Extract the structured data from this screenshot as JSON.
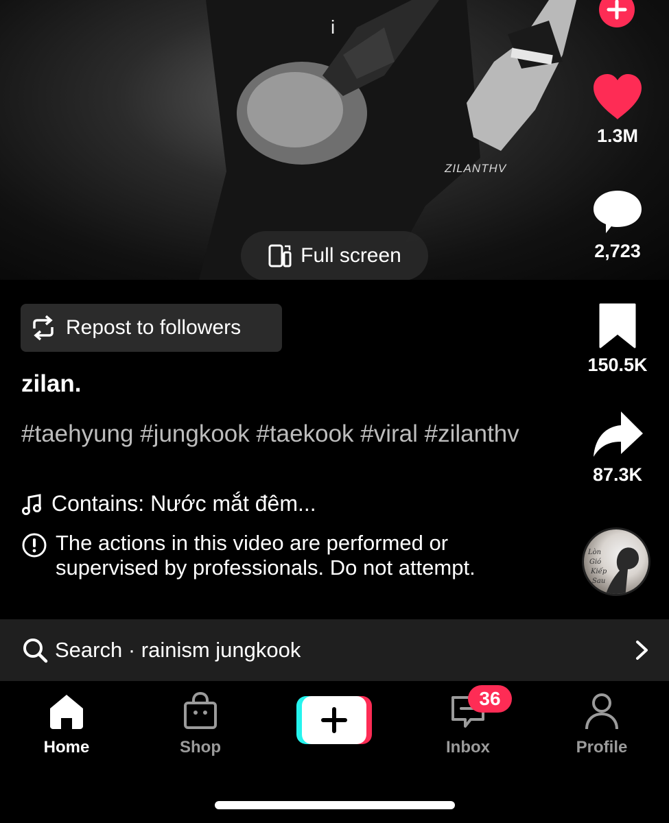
{
  "video": {
    "watermark": "ZILANTHV",
    "glyph": "i",
    "fullscreen_label": "Full screen"
  },
  "actions": {
    "likes": "1.3M",
    "comments": "2,723",
    "bookmarks": "150.5K",
    "shares": "87.3K",
    "like_color": "#fe2c55"
  },
  "post": {
    "repost_label": "Repost to followers",
    "username": "zilan.",
    "hashtags": "#taehyung #jungkook #taekook #viral #zilanthv",
    "music": "Contains: Nước mắt đêm...",
    "warning": "The actions in this video are performed or supervised by professionals. Do not attempt."
  },
  "search": {
    "text": "Search · rainism jungkook"
  },
  "nav": {
    "home": "Home",
    "shop": "Shop",
    "inbox": "Inbox",
    "inbox_badge": "36",
    "profile": "Profile"
  },
  "icons": [
    "heart-icon",
    "comment-icon",
    "bookmark-icon",
    "share-icon",
    "follow-plus-icon",
    "repost-icon",
    "music-note-icon",
    "warning-icon",
    "search-icon",
    "chevron-right-icon",
    "home-icon",
    "shop-bag-icon",
    "create-plus-icon",
    "inbox-icon",
    "profile-icon",
    "fullscreen-icon"
  ]
}
